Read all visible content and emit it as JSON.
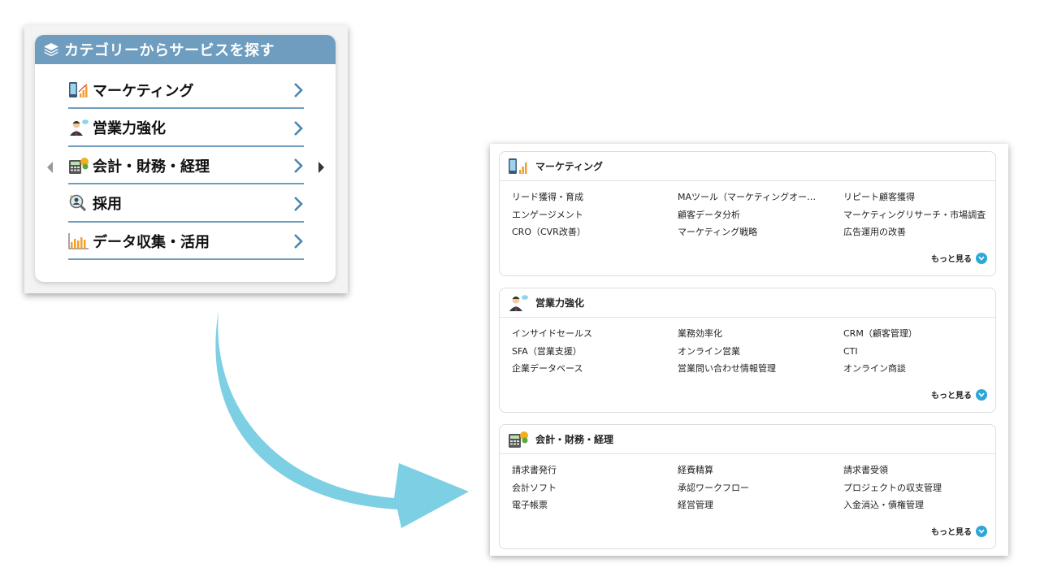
{
  "widget": {
    "header_title": "カテゴリーからサービスを探す",
    "items": [
      {
        "label": "マーケティング",
        "icon": "phone-chart-icon"
      },
      {
        "label": "営業力強化",
        "icon": "salesperson-icon"
      },
      {
        "label": "会計・財務・経理",
        "icon": "calculator-coin-icon"
      },
      {
        "label": "採用",
        "icon": "magnifier-person-icon"
      },
      {
        "label": "データ収集・活用",
        "icon": "bar-chart-icon"
      }
    ]
  },
  "panel": {
    "sections": [
      {
        "title": "マーケティング",
        "icon": "phone-chart-icon",
        "links": [
          "リード獲得・育成",
          "MAツール（マーケティングオー…",
          "リピート顧客獲得",
          "エンゲージメント",
          "顧客データ分析",
          "マーケティングリサーチ・市場調査",
          "CRO（CVR改善）",
          "マーケティング戦略",
          "広告運用の改善"
        ],
        "more": "もっと見る"
      },
      {
        "title": "営業力強化",
        "icon": "salesperson-icon",
        "links": [
          "インサイドセールス",
          "業務効率化",
          "CRM（顧客管理）",
          "SFA（営業支援）",
          "オンライン営業",
          "CTI",
          "企業データベース",
          "営業問い合わせ情報管理",
          "オンライン商談"
        ],
        "more": "もっと見る"
      },
      {
        "title": "会計・財務・経理",
        "icon": "calculator-coin-icon",
        "links": [
          "請求書発行",
          "経費精算",
          "請求書受領",
          "会計ソフト",
          "承認ワークフロー",
          "プロジェクトの収支管理",
          "電子帳票",
          "経営管理",
          "入金消込・債権管理"
        ],
        "more": "もっと見る"
      }
    ]
  },
  "colors": {
    "header_blue": "#6e9dbf",
    "arrow_cyan": "#7dcfe3",
    "more_circle": "#2ea6d6"
  }
}
